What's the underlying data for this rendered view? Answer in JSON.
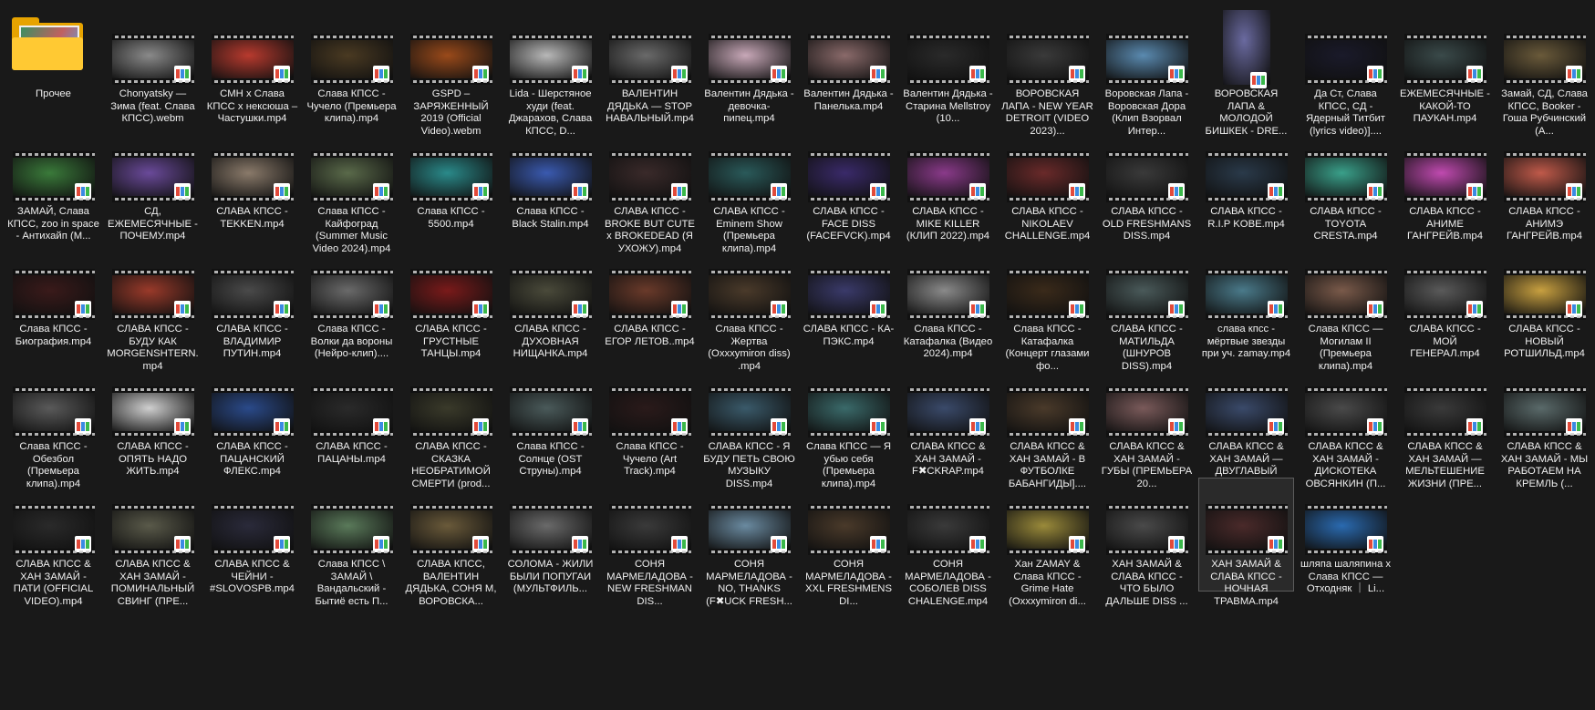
{
  "items": [
    {
      "label": "Прочее",
      "type": "folder"
    },
    {
      "label": "Chonyatsky — Зима (feat. Слава КПСС).webm",
      "color": "#8a8a8a"
    },
    {
      "label": "CMH x Слава КПСС x нексюша – Частушки.mp4",
      "color": "#b83a2e"
    },
    {
      "label": "Слава КПСС - Чучело (Премьера клипа).mp4",
      "color": "#4a3a22"
    },
    {
      "label": "GSPD – ЗАРЯЖЕННЫЙ 2019 (Official Video).webm",
      "color": "#9a4a1a"
    },
    {
      "label": "Lida - Шерстяное худи (feat. Джарахов, Слава КПСС, D...",
      "color": "#b8b8b8"
    },
    {
      "label": "ВАЛЕНТИН ДЯДЬКА — STOP НАВАЛЬНЫЙ.mp4",
      "color": "#6a6a6a"
    },
    {
      "label": "Валентин Дядька - девочка-пипец.mp4",
      "color": "#c8a8b8"
    },
    {
      "label": "Валентин Дядька - Панелька.mp4",
      "color": "#8a6a6a"
    },
    {
      "label": "Валентин Дядька - Старина Mellstroy (10...",
      "color": "#2a2a2a"
    },
    {
      "label": "ВОРОВСКАЯ ЛАПА - NEW YEAR DETROIT (VIDEO 2023)...",
      "color": "#3a3a3a"
    },
    {
      "label": "Воровская Лапа - Воровская Дора (Клип Взорвал Интер...",
      "color": "#5a8ab0"
    },
    {
      "label": "ВОРОВСКАЯ ЛАПА & МОЛОДОЙ БИШКЕК - DRE...",
      "color": "#6a6aa0",
      "tall": true
    },
    {
      "label": "Да Ст, Слава КПСС, СД - Ядерный Титбит (lyrics video)]....",
      "color": "#1a1a2a"
    },
    {
      "label": "ЕЖЕМЕСЯЧНЫЕ - КАКОЙ-ТО ПАУКАН.mp4",
      "color": "#3a4a4a"
    },
    {
      "label": "Замай, СД, Слава КПСС, Booker - Гоша Рубчинский (А...",
      "color": "#6a5a3a"
    },
    {
      "label": "ЗАМАЙ, Слава КПСС, zoo in space - Антихайп (М...",
      "color": "#3a7a3a"
    },
    {
      "label": "СД, ЕЖЕМЕСЯЧНЫЕ - ПОЧЕМУ.mp4",
      "color": "#6a4a9a"
    },
    {
      "label": "СЛАВА КПСС - TEKKEN.mp4",
      "color": "#8a7a6a"
    },
    {
      "label": "Слава КПСС - Кайфоград (Summer Music Video 2024).mp4",
      "color": "#5a6a4a"
    },
    {
      "label": "Слава КПСС - 5500.mp4",
      "color": "#2a8a8a"
    },
    {
      "label": "Слава КПСС - Black Stalin.mp4",
      "color": "#3a5ab0"
    },
    {
      "label": "СЛАВА КПСС - BROKE BUT CUTE x BROKEDEAD (Я УХОЖУ).mp4",
      "color": "#3a2a2a"
    },
    {
      "label": "СЛАВА КПСС - Eminem Show (Премьера клипа).mp4",
      "color": "#2a5a5a"
    },
    {
      "label": "СЛАВА КПСС - FACE DISS (FACEFVCK).mp4",
      "color": "#3a2a6a"
    },
    {
      "label": "СЛАВА КПСС - MIKE KILLER (КЛИП 2022).mp4",
      "color": "#8a3a8a"
    },
    {
      "label": "СЛАВА КПСС - NIKOLAEV CHALLENGE.mp4",
      "color": "#6a2a2a"
    },
    {
      "label": "СЛАВА КПСС - OLD FRESHMANS DISS.mp4",
      "color": "#3a3a3a"
    },
    {
      "label": "СЛАВА КПСС - R.I.P KOBE.mp4",
      "color": "#2a3a4a"
    },
    {
      "label": "СЛАВА КПСС - TOYOTA CRESTA.mp4",
      "color": "#3aa08a"
    },
    {
      "label": "СЛАВА КПСС - АНИМЕ ГАНГРЕЙВ.mp4",
      "color": "#c04ab0"
    },
    {
      "label": "СЛАВА КПСС - АНИМЭ ГАНГРЕЙВ.mp4",
      "color": "#c05a4a"
    },
    {
      "label": "Слава КПСС - Биография.mp4",
      "color": "#3a1a1a"
    },
    {
      "label": "СЛАВА КПСС - БУДУ КАК MORGENSHTERN.mp4",
      "color": "#9a3a2a"
    },
    {
      "label": "СЛАВА КПСС - ВЛАДИМИР ПУТИН.mp4",
      "color": "#4a4a4a"
    },
    {
      "label": "Слава КПСС - Волки да вороны (Нейро-клип)....",
      "color": "#6a6a6a"
    },
    {
      "label": "СЛАВА КПСС - ГРУСТНЫЕ ТАНЦЫ.mp4",
      "color": "#7a1a1a"
    },
    {
      "label": "СЛАВА КПСС - ДУХОВНАЯ НИЩАНКА.mp4",
      "color": "#4a4a3a"
    },
    {
      "label": "СЛАВА КПСС - ЕГОР ЛЕТОВ..mp4",
      "color": "#6a3a2a"
    },
    {
      "label": "Слава КПСС - Жертва (Oxxxymiron diss) .mp4",
      "color": "#4a3a2a"
    },
    {
      "label": "СЛАВА КПСС - КА-ПЭКС.mp4",
      "color": "#3a3a6a"
    },
    {
      "label": "Слава КПСС - Катафалка (Видео 2024).mp4",
      "color": "#8a8a8a"
    },
    {
      "label": "Слава КПСС - Катафалка (Концерт глазами фо...",
      "color": "#3a2a1a"
    },
    {
      "label": "СЛАВА КПСС - МАТИЛЬДА (ШНУРОВ DISS).mp4",
      "color": "#4a5a5a"
    },
    {
      "label": "слава кпсс - мёртвые звезды при уч. zamay.mp4",
      "color": "#4a7a8a"
    },
    {
      "label": "Слава КПСС — Могилам II (Премьера клипа).mp4",
      "color": "#7a5a4a"
    },
    {
      "label": "СЛАВА КПСС - МОЙ ГЕНЕРАЛ.mp4",
      "color": "#5a5a5a"
    },
    {
      "label": "СЛАВА КПСС - НОВЫЙ РОТШИЛЬД.mp4",
      "color": "#c8a040"
    },
    {
      "label": "Слава КПСС - Обезбол (Премьера клипа).mp4",
      "color": "#5a5a5a"
    },
    {
      "label": "СЛАВА КПСС - ОПЯТЬ НАДО ЖИТЬ.mp4",
      "color": "#cfcfcf"
    },
    {
      "label": "СЛАВА КПСС - ПАЦАНСКИЙ ФЛЕКС.mp4",
      "color": "#2a4a8a"
    },
    {
      "label": "СЛАВА КПСС - ПАЦАНЫ.mp4",
      "color": "#2a2a2a"
    },
    {
      "label": "СЛАВА КПСС - СКАЗКА НЕОБРАТИМОЙ СМЕРТИ (prod...",
      "color": "#3a3a2a"
    },
    {
      "label": "Слава КПСС - Солнце (OST Струны).mp4",
      "color": "#4a5a5a"
    },
    {
      "label": "Слава КПСС - Чучело (Art Track).mp4",
      "color": "#2a1a1a"
    },
    {
      "label": "СЛАВА КПСС - Я БУДУ ПЕТЬ СВОЮ МУЗЫКУ DISS.mp4",
      "color": "#3a5a6a"
    },
    {
      "label": "Слава КПСС — Я убью себя (Премьера клипа).mp4",
      "color": "#3a6a6a"
    },
    {
      "label": "СЛАВА КПСС & ХАН ЗАМАЙ - F✖CKRAP.mp4",
      "color": "#3a4a6a"
    },
    {
      "label": "СЛАВА КПСС & ХАН ЗАМАЙ - В ФУТБОЛКЕ БАБАНГИДЫ]....",
      "color": "#4a3a2a"
    },
    {
      "label": "СЛАВА КПСС & ХАН ЗАМАЙ - ГУБЫ (ПРЕМЬЕРА 20...",
      "color": "#7a5a5a"
    },
    {
      "label": "СЛАВА КПСС & ХАН ЗАМАЙ — ДВУГЛАВЫЙ ОРЁЛ (ПРЕМЬ...",
      "color": "#3a4a6a"
    },
    {
      "label": "СЛАВА КПСС & ХАН ЗАМАЙ - ДИСКОТЕКА ОВСЯНКИН (П...",
      "color": "#4a4a4a"
    },
    {
      "label": "СЛАВА КПСС & ХАН ЗАМАЙ — МЕЛЬТЕШЕНИЕ ЖИЗНИ (ПРЕ...",
      "color": "#3a3a3a"
    },
    {
      "label": "СЛАВА КПСС & ХАН ЗАМАЙ - МЫ РАБОТАЕМ НА КРЕМЛЬ (...",
      "color": "#5a6a6a"
    },
    {
      "label": "СЛАВА КПСС & ХАН ЗАМАЙ - ПАТИ (OFFICIAL VIDEO).mp4",
      "color": "#2a2a2a"
    },
    {
      "label": "СЛАВА КПСС & ХАН ЗАМАЙ - ПОМИНАЛЬНЫЙ СВИНГ (ПРЕ...",
      "color": "#5a5a4a"
    },
    {
      "label": "СЛАВА КПСС & ЧЕЙНИ - #SLOVOSPB.mp4",
      "color": "#2a2a3a"
    },
    {
      "label": "Слава КПСС \\ ЗАМАЙ \\ Вандальский - Бытиё есть П...",
      "color": "#5a7a5a"
    },
    {
      "label": "СЛАВА КПСС, ВАЛЕНТИН ДЯДЬКА, СОНЯ М, ВОРОВСКА...",
      "color": "#6a5a3a"
    },
    {
      "label": "СОЛОМА - ЖИЛИ БЫЛИ ПОПУГАИ (МУЛЬТФИЛЬ...",
      "color": "#6a6a6a"
    },
    {
      "label": "СОНЯ МАРМЕЛАДОВА - NEW FRESHMAN DIS...",
      "color": "#3a3a3a"
    },
    {
      "label": "СОНЯ МАРМЕЛАДОВА - NO, THANKS (F✖UCK FRESH...",
      "color": "#6a8aa0"
    },
    {
      "label": "СОНЯ МАРМЕЛАДОВА - XXL FRESHMENS DI...",
      "color": "#4a3a2a"
    },
    {
      "label": "СОНЯ МАРМЕЛАДОВА - СОБОЛЕВ DISS CHALENGE.mp4",
      "color": "#3a3a3a"
    },
    {
      "label": "Хан ZAMAY & Слава КПСС - Grime Hate (Oxxxymiron di...",
      "color": "#9a8a3a"
    },
    {
      "label": "ХАН ЗАМАЙ & СЛАВА КПСС - ЧТО БЫЛО ДАЛЬШЕ DISS ...",
      "color": "#4a4a4a"
    },
    {
      "label": "ХАН ЗАМАЙ & СЛАВА КПСС - НОЧНАЯ ТРАВМА.mp4",
      "color": "#4a2a2a",
      "selected": true
    },
    {
      "label": "шляпа шаляпина х Слава КПСС — Отходняк ｜ Li...",
      "color": "#2a6ab0"
    }
  ]
}
